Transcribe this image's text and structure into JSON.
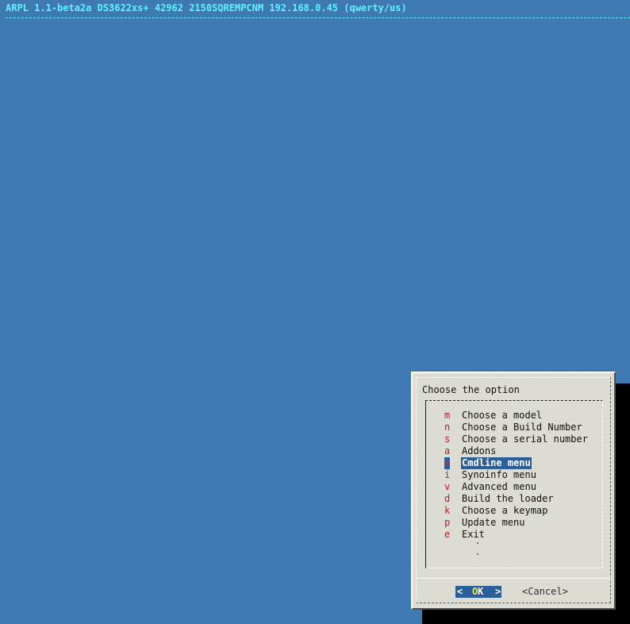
{
  "header": {
    "title": "ARPL 1.1-beta2a DS3622xs+ 42962 2150SQREMPCNM 192.168.0.45 (qwerty/us)"
  },
  "dialog": {
    "prompt": "Choose the option",
    "selected_key": "x",
    "menu": [
      {
        "key": "m",
        "label": "Choose a model"
      },
      {
        "key": "n",
        "label": "Choose a Build Number"
      },
      {
        "key": "s",
        "label": "Choose a serial number"
      },
      {
        "key": "a",
        "label": "Addons"
      },
      {
        "key": "x",
        "label": "Cmdline menu"
      },
      {
        "key": "i",
        "label": "Synoinfo menu"
      },
      {
        "key": "v",
        "label": "Advanced menu"
      },
      {
        "key": "d",
        "label": "Build the loader"
      },
      {
        "key": "k",
        "label": "Choose a keymap"
      },
      {
        "key": "p",
        "label": "Update menu"
      },
      {
        "key": "e",
        "label": "Exit"
      }
    ],
    "buttons": {
      "ok": {
        "left": "<",
        "hotkey": "O",
        "rest": "K",
        "right": ">"
      },
      "cancel": "<Cancel>"
    }
  },
  "colors": {
    "background": "#3f79b2",
    "title_text": "#5ff3ff",
    "dialog_bg": "#dcdcd4",
    "selection": "#2b5f9a",
    "menu_key": "#c31c1c",
    "hotkey": "#f0e850"
  }
}
